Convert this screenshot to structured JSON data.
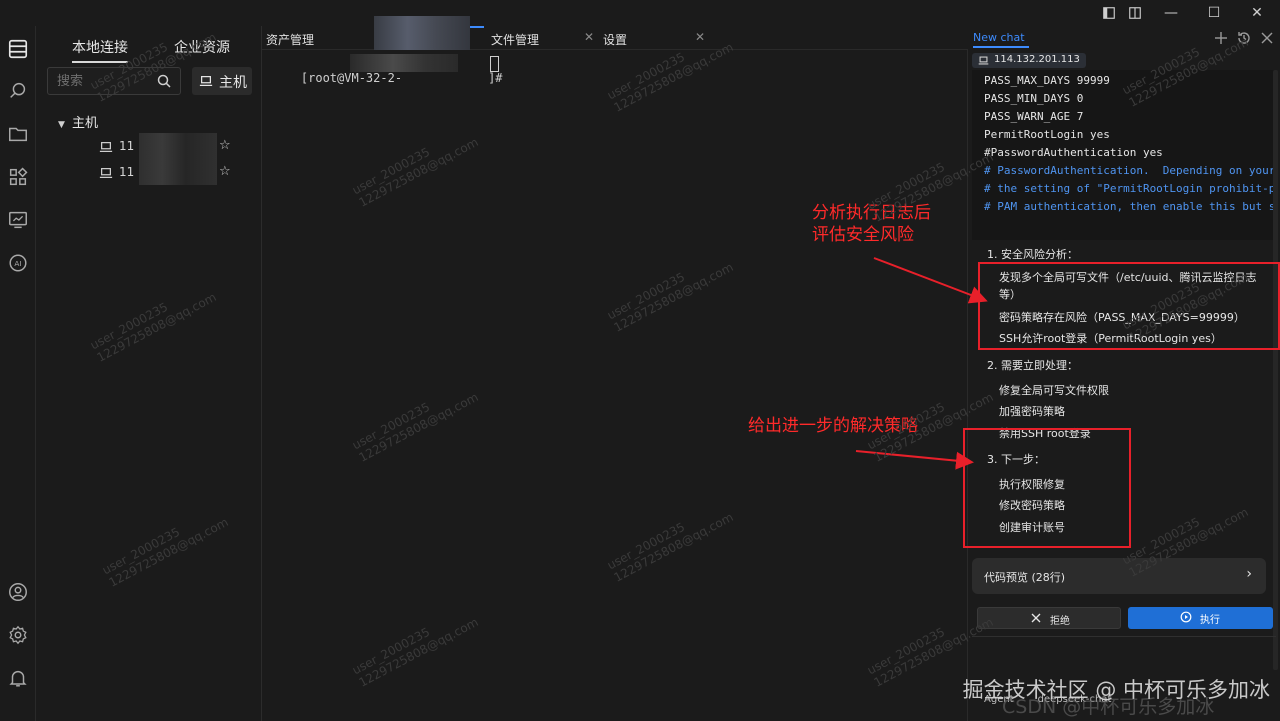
{
  "window": {
    "minimize": "—",
    "maximize": "☐",
    "close": "✕"
  },
  "sidebar": {
    "tabs": [
      "本地连接",
      "企业资源"
    ],
    "search_placeholder": "搜索",
    "host_button": "主机",
    "tree_root": "主机",
    "hosts": [
      {
        "prefix": "11"
      },
      {
        "prefix": "11"
      }
    ]
  },
  "tabs": [
    {
      "label": "资产管理"
    },
    {
      "label": "文件管理"
    },
    {
      "label": "设置"
    }
  ],
  "terminal": {
    "prompt_start": "[root@VM-32-2-",
    "prompt_end": "]#"
  },
  "chat": {
    "tab_label": "New chat",
    "server_ip": "114.132.201.113",
    "code_lines": [
      {
        "text": "PASS_MAX_DAYS 99999",
        "comment": false
      },
      {
        "text": "PASS_MIN_DAYS 0",
        "comment": false
      },
      {
        "text": "PASS_WARN_AGE 7",
        "comment": false
      },
      {
        "text": "PermitRootLogin yes",
        "comment": false
      },
      {
        "text": "#PasswordAuthentication yes",
        "comment": false
      },
      {
        "text": "# PasswordAuthentication.  Depending on your P",
        "comment": true
      },
      {
        "text": "# the setting of \"PermitRootLogin prohibit-pas",
        "comment": true
      },
      {
        "text": "# PAM authentication, then enable this but set",
        "comment": true
      }
    ],
    "sections": [
      {
        "title": "1. 安全风险分析：",
        "items": [
          "发现多个全局可写文件（/etc/uuid、腾讯云监控日志等）",
          "密码策略存在风险（PASS_MAX_DAYS=99999）",
          "SSH允许root登录（PermitRootLogin yes）"
        ]
      },
      {
        "title": "2. 需要立即处理：",
        "items": [
          "修复全局可写文件权限",
          "加强密码策略",
          "禁用SSH root登录"
        ]
      },
      {
        "title": "3. 下一步：",
        "items": [
          "执行权限修复",
          "修改密码策略",
          "创建审计账号"
        ]
      }
    ],
    "code_preview": "代码预览 (28行)",
    "reject_label": "拒绝",
    "execute_label": "执行",
    "modes": [
      "Agent",
      "deepseek-chat"
    ]
  },
  "annotations": {
    "analysis": [
      "分析执行日志后",
      "评估安全风险"
    ],
    "solution": "给出进一步的解决策略"
  },
  "watermark": {
    "user": "user_2000235",
    "email": "1229725808@qq.com",
    "footer": "掘金技术社区 @ 中杯可乐多加冰",
    "footer2": "CSDN @中杯可乐多加冰"
  },
  "colors": {
    "accent": "#3d8bfd",
    "annotation": "#e8202a",
    "comment": "#4f94f0"
  }
}
